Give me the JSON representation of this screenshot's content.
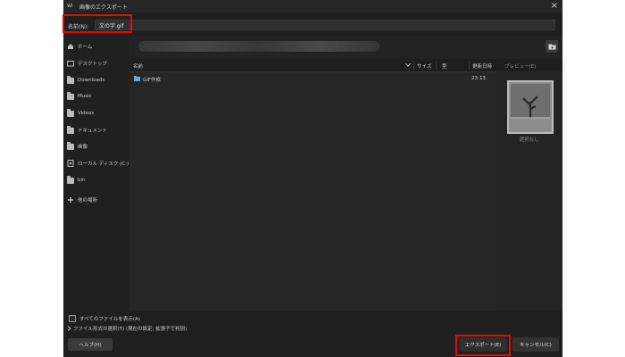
{
  "window": {
    "title": "画像のエクスポート",
    "app_icon_label": "wi",
    "close_symbol": "×"
  },
  "name_field": {
    "label": "名前(N):",
    "value": "文の字.gif"
  },
  "sidebar": {
    "items": [
      {
        "label": "ホーム",
        "icon": "home-icon"
      },
      {
        "label": "デスクトップ",
        "icon": "desktop-folder-icon"
      },
      {
        "label": "Downloads",
        "icon": "folder-icon"
      },
      {
        "label": "Music",
        "icon": "folder-icon"
      },
      {
        "label": "Videos",
        "icon": "folder-icon"
      },
      {
        "label": "ドキュメント",
        "icon": "folder-icon"
      },
      {
        "label": "画像",
        "icon": "folder-icon"
      },
      {
        "label": "ローカル ディスク (C:)",
        "icon": "drive-icon"
      },
      {
        "label": "bin",
        "icon": "folder-icon"
      },
      {
        "label": "他の場所",
        "icon": "plus-icon"
      }
    ]
  },
  "toolbar": {
    "new_folder_icon": "new-folder-icon"
  },
  "file_list": {
    "columns": {
      "name": "名前",
      "size": "サイズ",
      "type": "型",
      "modified": "更新日時"
    },
    "rows": [
      {
        "name": "GIF作成",
        "modified": "23:13"
      }
    ]
  },
  "preview": {
    "title": "プレビュー(E)",
    "no_selection": "選択なし"
  },
  "bottom": {
    "show_all_files": "すべてのファイルを表示(A)",
    "file_type_select": "ファイル形式の選択(T) (現在の設定: 拡張子で判別)",
    "help_button": "ヘルプ(H)",
    "export_button": "エクスポート(E)",
    "cancel_button": "キャンセル(C)"
  },
  "colors": {
    "highlight": "#e50b0b",
    "folder_blue": "#6aa7de"
  }
}
